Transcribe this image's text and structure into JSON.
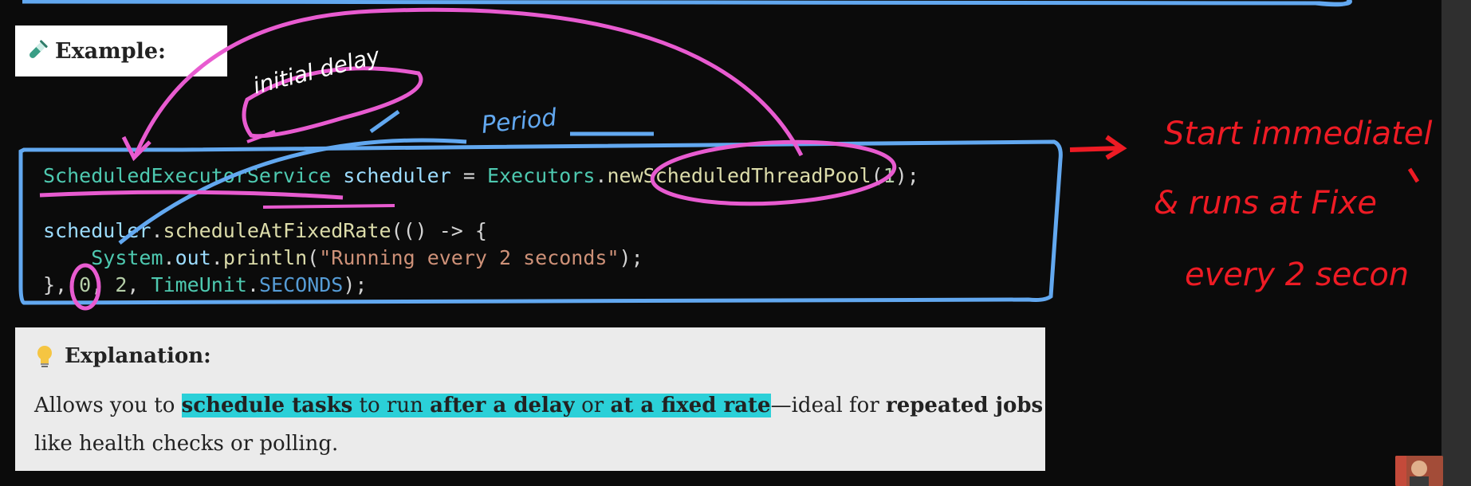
{
  "example": {
    "label": "Example:",
    "icon": "test-tube-icon"
  },
  "code": {
    "line1": {
      "type": "ScheduledExecutorService",
      "var": "scheduler",
      "eq": "=",
      "cls": "Executors",
      "fn": "newScheduledThreadPool",
      "arg": "1",
      "end": ");"
    },
    "line2": {
      "var": "scheduler",
      "fn": "scheduleAtFixedRate",
      "lambda": "(() ->",
      "brace": "{"
    },
    "line3": {
      "cls": "System",
      "field": "out",
      "fn": "println",
      "str": "\"Running every 2 seconds\"",
      "end": ");"
    },
    "line4": {
      "start": "},",
      "n0": "0",
      "n2": "2",
      "cls": "TimeUnit",
      "const": "SECONDS",
      "end": ");"
    }
  },
  "explanation": {
    "icon": "lightbulb-icon",
    "title": "Explanation:",
    "t1": "Allows you to ",
    "t2": "schedule tasks",
    "t3": " to run ",
    "t4": "after a delay",
    "t5": " or ",
    "t6": "at a fixed rate",
    "t7": "—ideal for ",
    "t8": "repeated jobs",
    "t9": " like health checks or polling."
  },
  "annotations": {
    "initial_delay": "initial delay",
    "period": "Period",
    "right_line1": "Start immediatel",
    "right_line2": "& runs at Fixe",
    "right_line3": "every 2 secon"
  },
  "colors": {
    "ink_pink": "#e85bd0",
    "ink_blue": "#62a8f0",
    "ink_red": "#ee1b24",
    "highlight": "#2bd0d8"
  }
}
